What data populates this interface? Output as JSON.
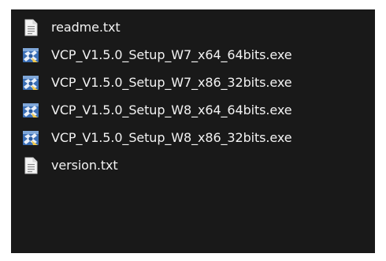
{
  "theme": {
    "background": "#191919",
    "text": "#f2f2f2",
    "page_background": "#ffffff"
  },
  "files": [
    {
      "name": "readme.txt",
      "icon": "text-file-icon"
    },
    {
      "name": "VCP_V1.5.0_Setup_W7_x64_64bits.exe",
      "icon": "installer-exe-icon"
    },
    {
      "name": "VCP_V1.5.0_Setup_W7_x86_32bits.exe",
      "icon": "installer-exe-icon"
    },
    {
      "name": "VCP_V1.5.0_Setup_W8_x64_64bits.exe",
      "icon": "installer-exe-icon"
    },
    {
      "name": "VCP_V1.5.0_Setup_W8_x86_32bits.exe",
      "icon": "installer-exe-icon"
    },
    {
      "name": "version.txt",
      "icon": "text-file-icon"
    }
  ]
}
